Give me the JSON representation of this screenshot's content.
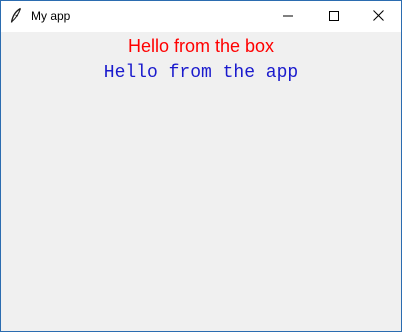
{
  "window": {
    "title": "My app",
    "icons": {
      "app": "feather-icon",
      "minimize": "minimize-icon",
      "maximize": "maximize-icon",
      "close": "close-icon"
    }
  },
  "content": {
    "box_message": "Hello from the box",
    "app_message": "Hello from the app"
  },
  "colors": {
    "box_message": "#ff0000",
    "app_message": "#1a1acd",
    "background": "#f0f0f0",
    "titlebar": "#ffffff"
  }
}
